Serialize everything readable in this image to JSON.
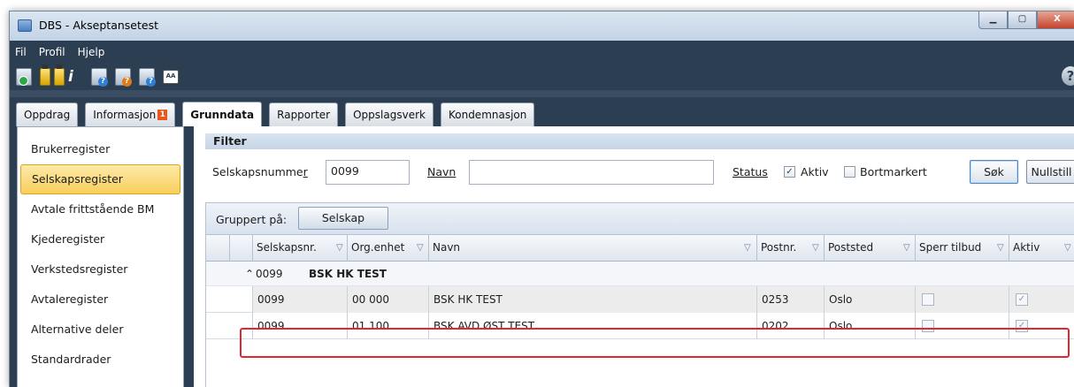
{
  "window": {
    "title": "DBS - Akseptansetest",
    "buttons": {
      "minimize": "▁",
      "maximize": "▢",
      "close": "X"
    }
  },
  "menu": [
    "Fil",
    "Profil",
    "Hjelp"
  ],
  "toolbar": {
    "aa_label": "AA",
    "help_glyph": "?",
    "info_glyph": "i"
  },
  "tabs": [
    {
      "label": "Oppdrag"
    },
    {
      "label": "Informasjon",
      "badge": "1"
    },
    {
      "label": "Grunndata",
      "active": true
    },
    {
      "label": "Rapporter"
    },
    {
      "label": "Oppslagsverk"
    },
    {
      "label": "Kondemnasjon"
    }
  ],
  "sidebar": {
    "items": [
      "Brukerregister",
      "Selskapsregister",
      "Avtale frittstående BM",
      "Kjederegister",
      "Verkstedsregister",
      "Avtaleregister",
      "Alternative deler",
      "Standardrader"
    ],
    "selected": "Selskapsregister"
  },
  "filter": {
    "title": "Filter",
    "selskapsnummer_label": "Selskapsnumme",
    "selskapsnummer_label_ul": "r",
    "selskapsnummer_value": "0099",
    "navn_label": "Navn",
    "navn_value": "",
    "status_label": "Status",
    "aktiv_label": "Aktiv",
    "aktiv_checked": true,
    "bortmarkert_label": "Bortmarkert",
    "bortmarkert_checked": false,
    "search_button": "Søk",
    "reset_button": "Nullstill"
  },
  "grid": {
    "grouped_label": "Gruppert på:",
    "group_chip": "Selskap",
    "columns": [
      "Selskapsnr.",
      "Org.enhet",
      "Navn",
      "Postnr.",
      "Poststed",
      "Sperr tilbud",
      "Aktiv"
    ],
    "group_row": {
      "expander": "⌃",
      "number": "0099",
      "name": "BSK HK  TEST"
    },
    "rows": [
      {
        "selskapsnr": "0099",
        "orgenhet": "00 000",
        "navn": "BSK HK  TEST",
        "postnr": "0253",
        "poststed": "Oslo",
        "sperr_tilbud": false,
        "aktiv": true,
        "highlighted": true
      },
      {
        "selskapsnr": "0099",
        "orgenhet": "01 100",
        "navn": "BSK AVD ØST TEST",
        "postnr": "0202",
        "poststed": "Oslo",
        "sperr_tilbud": false,
        "aktiv": true,
        "highlighted": false
      }
    ]
  },
  "colors": {
    "frame": "#2c3e52",
    "selected_item": "#f8cf5c",
    "highlight_box": "#e02833",
    "badge": "#e8561c"
  }
}
